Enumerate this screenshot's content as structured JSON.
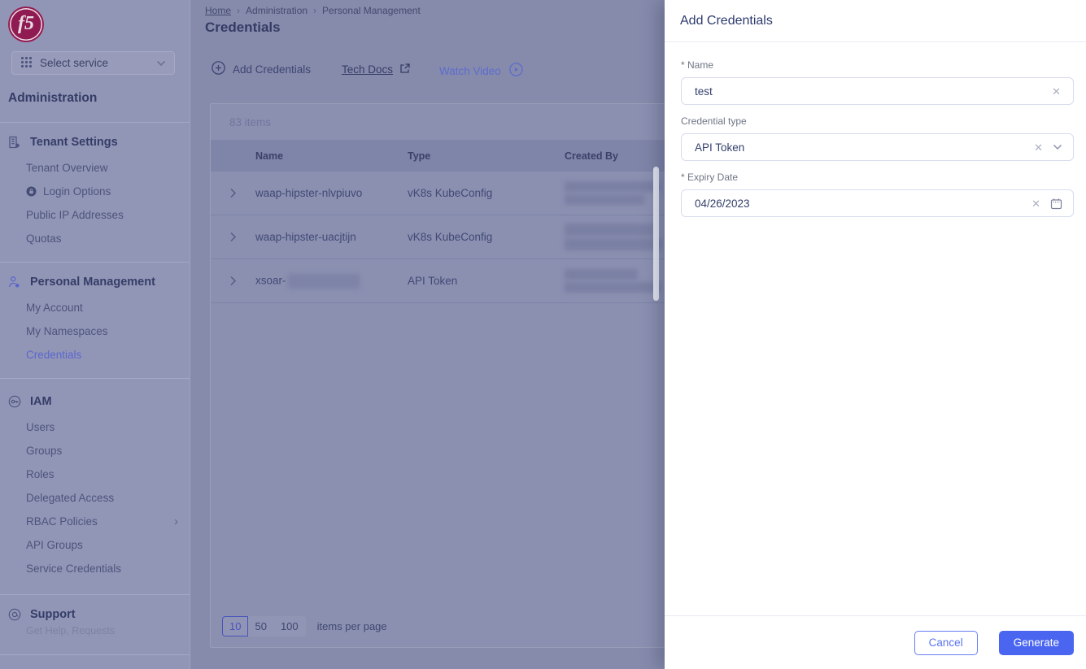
{
  "colors": {
    "accent_blue": "#4a66f0",
    "brand_crimson": "#8f1b52",
    "active_link_blue": "#5a66cc"
  },
  "icons": {
    "clear": "✕",
    "chevron_right": "›",
    "breadcrumb_sep": "›"
  },
  "sidebar": {
    "logo_text": "f5",
    "service_selector": {
      "label": "Select service"
    },
    "heading": "Administration",
    "sections": [
      {
        "title": "Tenant Settings",
        "items": [
          {
            "label": "Tenant Overview"
          },
          {
            "label": "Login Options",
            "locked": true
          },
          {
            "label": "Public IP Addresses"
          },
          {
            "label": "Quotas"
          }
        ]
      },
      {
        "title": "Personal Management",
        "items": [
          {
            "label": "My Account"
          },
          {
            "label": "My Namespaces"
          },
          {
            "label": "Credentials",
            "active": true
          }
        ]
      },
      {
        "title": "IAM",
        "items": [
          {
            "label": "Users"
          },
          {
            "label": "Groups"
          },
          {
            "label": "Roles"
          },
          {
            "label": "Delegated Access"
          },
          {
            "label": "RBAC Policies",
            "has_submenu": true
          },
          {
            "label": "API Groups"
          },
          {
            "label": "Service Credentials"
          }
        ]
      },
      {
        "title": "Support",
        "subtitle": "Get Help, Requests",
        "items": []
      }
    ]
  },
  "breadcrumb": {
    "home": "Home",
    "level2": "Administration",
    "level3": "Personal Management"
  },
  "page_title": "Credentials",
  "toolbar": {
    "add_credentials": "Add Credentials",
    "tech_docs": "Tech Docs",
    "watch_video": "Watch Video"
  },
  "table": {
    "items_count": "83 items",
    "columns": [
      "Name",
      "Type",
      "Created By"
    ],
    "rows": [
      {
        "name": "waap-hipster-nlvpiuvo",
        "type": "vK8s KubeConfig",
        "created_by_redacted": true
      },
      {
        "name": "waap-hipster-uacjtijn",
        "type": "vK8s KubeConfig",
        "created_by_redacted": true
      },
      {
        "name": "xsoar-",
        "name_partially_redacted": true,
        "type": "API Token",
        "created_by_redacted": true
      }
    ]
  },
  "pagination": {
    "options": [
      "10",
      "50",
      "100"
    ],
    "selected": "10",
    "label": "items per page"
  },
  "panel": {
    "title": "Add Credentials",
    "name_label": "* Name",
    "name_value": "test",
    "type_label": "Credential type",
    "type_value": "API Token",
    "expiry_label": "* Expiry Date",
    "expiry_value": "04/26/2023",
    "cancel_label": "Cancel",
    "generate_label": "Generate"
  }
}
